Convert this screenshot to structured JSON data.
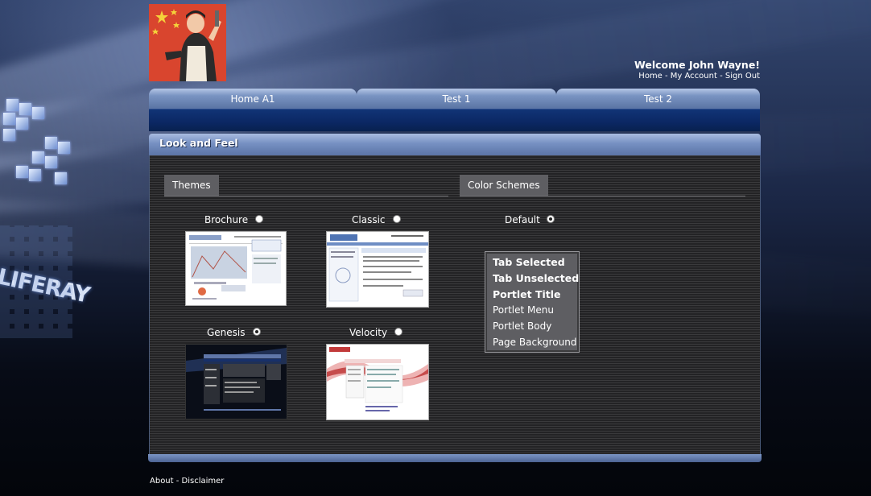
{
  "header": {
    "welcome": "Welcome John Wayne!",
    "links": [
      {
        "label": "Home"
      },
      {
        "label": "My Account"
      },
      {
        "label": "Sign Out"
      }
    ],
    "separator": " - "
  },
  "nav": {
    "tabs": [
      {
        "label": "Home A1"
      },
      {
        "label": "Test 1"
      },
      {
        "label": "Test 2"
      }
    ]
  },
  "portlet": {
    "title": "Look and Feel",
    "themes_tab": "Themes",
    "color_schemes_tab": "Color Schemes",
    "themes": [
      {
        "name": "Brochure",
        "selected": false
      },
      {
        "name": "Classic",
        "selected": false
      },
      {
        "name": "Genesis",
        "selected": true
      },
      {
        "name": "Velocity",
        "selected": false
      }
    ],
    "color_schemes": [
      {
        "name": "Default",
        "selected": true,
        "preview_items": [
          "Tab Selected",
          "Tab Unselected",
          "Portlet Title",
          "Portlet Menu",
          "Portlet Body",
          "Page Background"
        ]
      }
    ]
  },
  "footer": {
    "links": [
      {
        "label": "About"
      },
      {
        "label": "Disclaimer"
      }
    ],
    "separator": " - "
  },
  "colors": {
    "tab_gradient_top": "#b4c6e6",
    "navbar": "#0b2763",
    "portlet_title": "#7690c2",
    "section_tab": "#5e5e62"
  }
}
